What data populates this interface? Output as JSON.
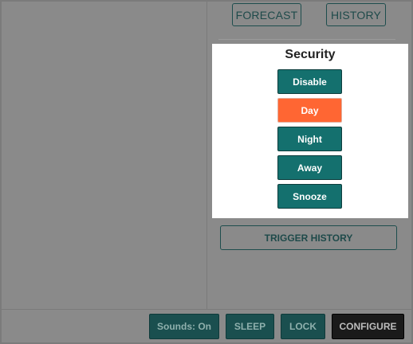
{
  "header": {
    "forecast_label": "FORECAST",
    "history_label": "HISTORY"
  },
  "security": {
    "title": "Security",
    "modes": [
      {
        "label": "Disable",
        "active": false
      },
      {
        "label": "Day",
        "active": true
      },
      {
        "label": "Night",
        "active": false
      },
      {
        "label": "Away",
        "active": false
      },
      {
        "label": "Snooze",
        "active": false
      }
    ],
    "active_color": "#ff6633",
    "button_color": "#14706e"
  },
  "trigger_history_label": "TRIGGER HISTORY",
  "footer": {
    "sounds_label": "Sounds: On",
    "sleep_label": "SLEEP",
    "lock_label": "LOCK",
    "configure_label": "CONFIGURE"
  }
}
